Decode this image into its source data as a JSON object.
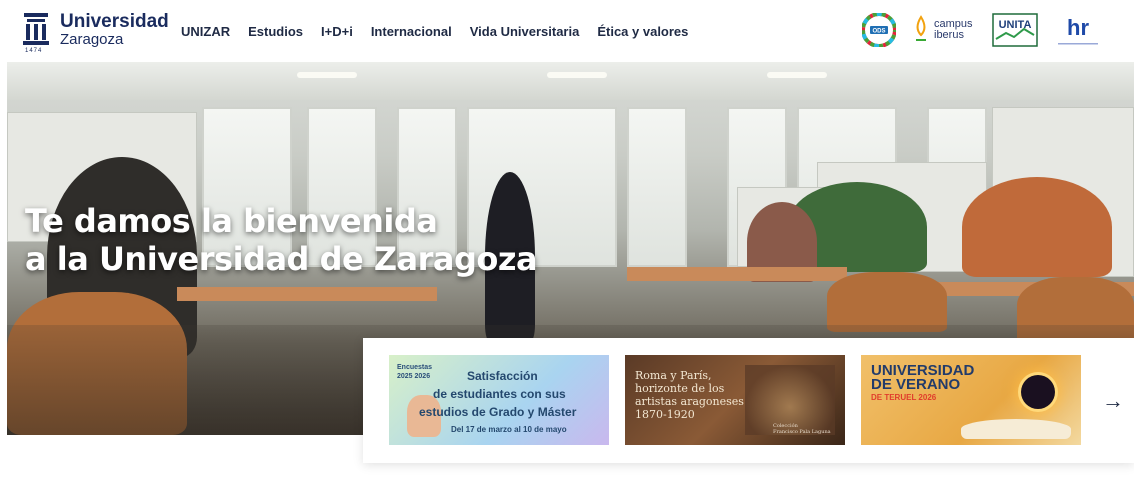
{
  "header": {
    "logo": {
      "name": "Universidad",
      "sub": "Zaragoza",
      "year": "1474"
    },
    "nav": [
      "UNIZAR",
      "Estudios",
      "I+D+i",
      "Internacional",
      "Vida Universitaria",
      "Ética y valores"
    ],
    "partners": {
      "ods": "ODS",
      "campus_line1": "campus",
      "campus_line2": "iberus",
      "unita": "UNITA",
      "hr": "hr"
    }
  },
  "hero": {
    "title_line1": "Te damos la bienvenida",
    "title_line2": "a la Universidad de Zaragoza"
  },
  "carousel": {
    "slides": [
      {
        "badge1": "Encuestas",
        "badge2": "2025 2026",
        "title": "Satisfacción",
        "line2": "de estudiantes con sus",
        "line3": "estudios de Grado y Máster",
        "date": "Del 17 de marzo al 10 de mayo"
      },
      {
        "title1": "Roma y París,",
        "title2": "horizonte de los",
        "title3": "artistas aragoneses",
        "title4": "1870-1920",
        "col1": "Colección",
        "col2": "Francisco Pala Laguna"
      },
      {
        "t1": "UNIVERSIDAD",
        "t2": "DE VERANO",
        "t3": "DE TERUEL 2026"
      }
    ],
    "next_arrow": "→"
  },
  "colors": {
    "brand": "#1a2b5e",
    "nav_text": "#1f2a44"
  }
}
